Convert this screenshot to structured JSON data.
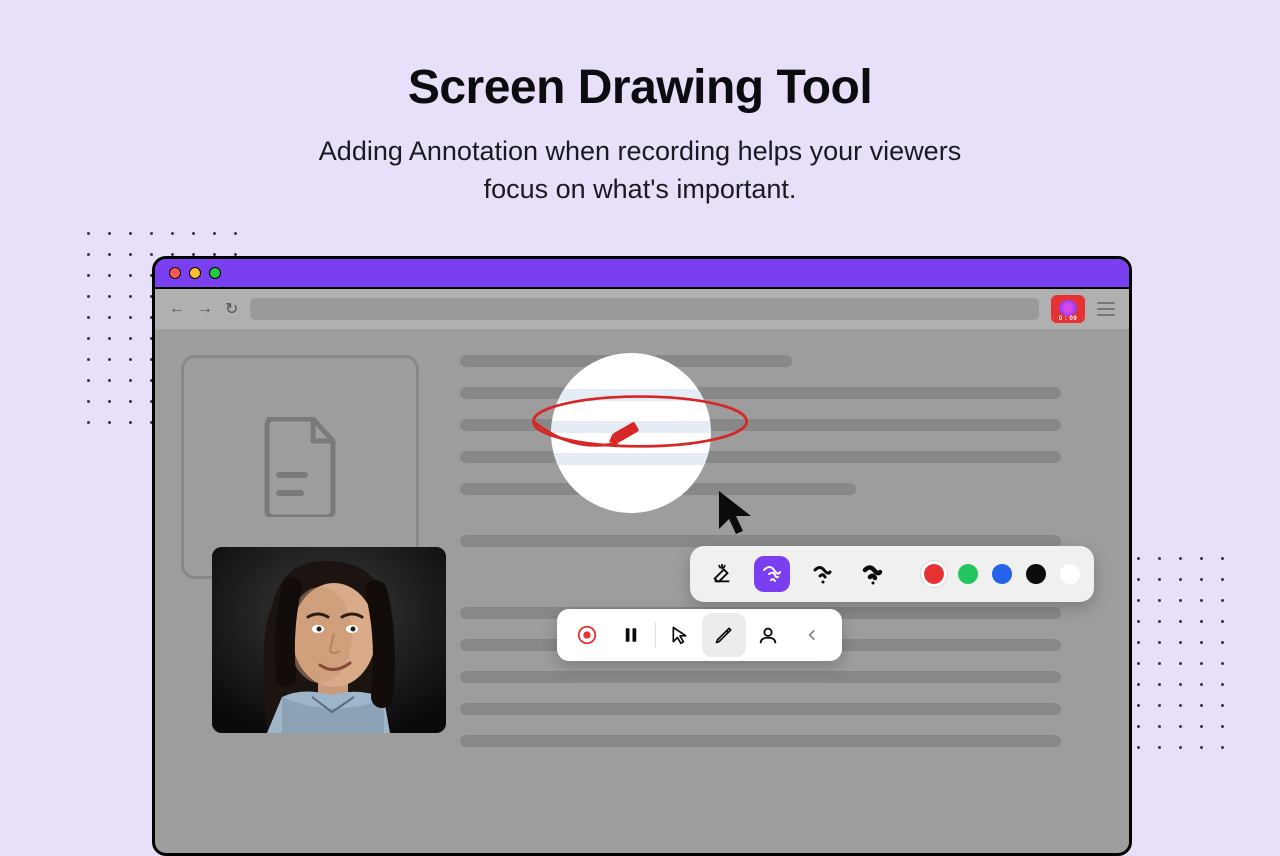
{
  "hero": {
    "title": "Screen Drawing Tool",
    "subtitle_line1": "Adding Annotation when recording helps your viewers",
    "subtitle_line2": "focus on what's important."
  },
  "browser": {
    "recording_timer": "0 : 09"
  },
  "draw_toolbar": {
    "tools": [
      {
        "name": "eraser-icon"
      },
      {
        "name": "pen-thin-icon",
        "selected": true
      },
      {
        "name": "pen-medium-icon"
      },
      {
        "name": "pen-thick-icon"
      }
    ],
    "colors": [
      {
        "name": "color-red",
        "hex": "#E63232",
        "active": true
      },
      {
        "name": "color-green",
        "hex": "#22C55E"
      },
      {
        "name": "color-blue",
        "hex": "#2563EB"
      },
      {
        "name": "color-black",
        "hex": "#0B0B0B"
      },
      {
        "name": "color-white",
        "hex": "#FFFFFF"
      }
    ]
  },
  "control_bar": {
    "buttons": [
      {
        "name": "record-button"
      },
      {
        "name": "pause-button"
      },
      {
        "name": "cursor-button"
      },
      {
        "name": "pencil-button",
        "active": true
      },
      {
        "name": "webcam-button"
      },
      {
        "name": "collapse-button"
      }
    ]
  }
}
